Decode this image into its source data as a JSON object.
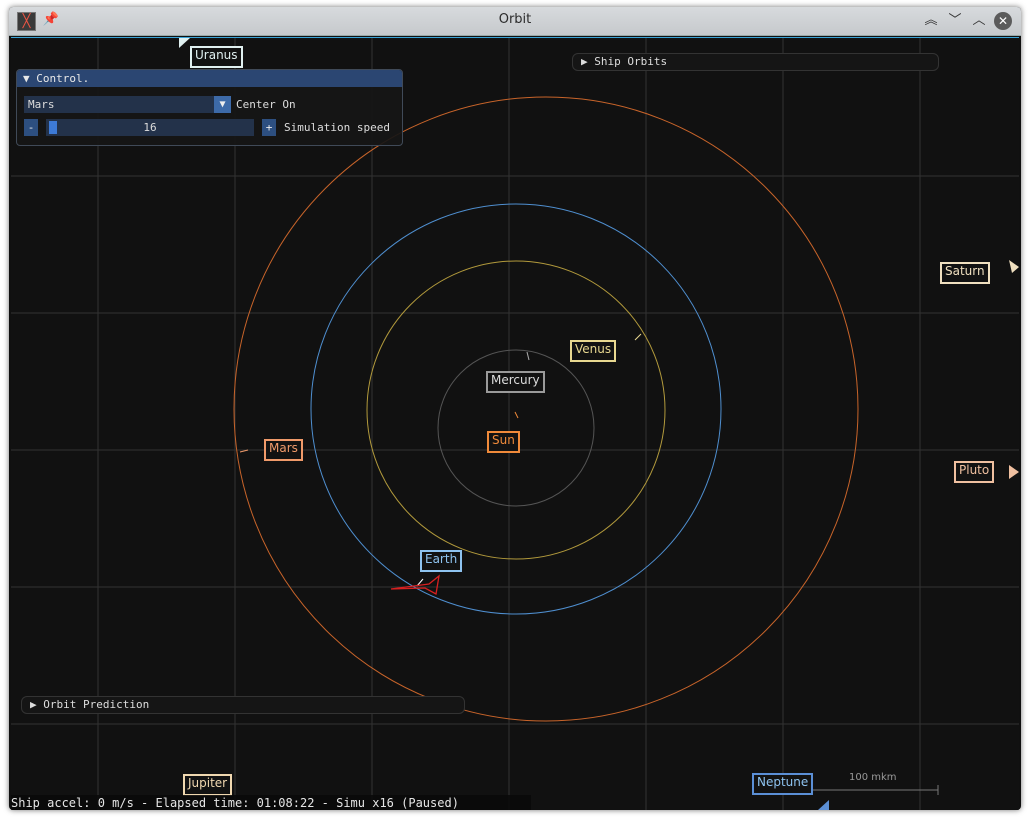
{
  "window": {
    "title": "Orbit",
    "app_icon": "app-logo-icon",
    "buttons": [
      "keep-above-icon",
      "minimize-icon",
      "maximize-icon",
      "close-icon"
    ]
  },
  "control_panel": {
    "title": "Control.",
    "center_on_value": "Mars",
    "center_on_label": "Center On",
    "speed_minus": "-",
    "speed_value": "16",
    "speed_plus": "+",
    "speed_label": "Simulation speed"
  },
  "ship_orbits": {
    "label": "Ship Orbits"
  },
  "orbit_prediction": {
    "label": "Orbit Prediction"
  },
  "planets": {
    "sun": {
      "name": "Sun",
      "color": "#f08a3a"
    },
    "mercury": {
      "name": "Mercury",
      "color": "#9a9a9a"
    },
    "venus": {
      "name": "Venus",
      "color": "#e8d890"
    },
    "earth": {
      "name": "Earth",
      "color": "#8ec3f0"
    },
    "mars": {
      "name": "Mars",
      "color": "#f09a6a"
    },
    "jupiter": {
      "name": "Jupiter",
      "color": "#f0d8b0"
    },
    "saturn": {
      "name": "Saturn",
      "color": "#f0e0c0"
    },
    "uranus": {
      "name": "Uranus",
      "color": "#e0f0f0"
    },
    "neptune": {
      "name": "Neptune",
      "color": "#5b8fd6"
    },
    "pluto": {
      "name": "Pluto",
      "color": "#f0c0a0"
    }
  },
  "orbit_colors": {
    "mercury": "#555555",
    "venus": "#b29a3c",
    "earth": "#4f8fd0",
    "mars": "#c8642a"
  },
  "scale": {
    "label": "100 mkm"
  },
  "status": {
    "text": "Ship accel: 0 m/s - Elapsed time: 01:08:22 - Simu x16 (Paused)"
  }
}
